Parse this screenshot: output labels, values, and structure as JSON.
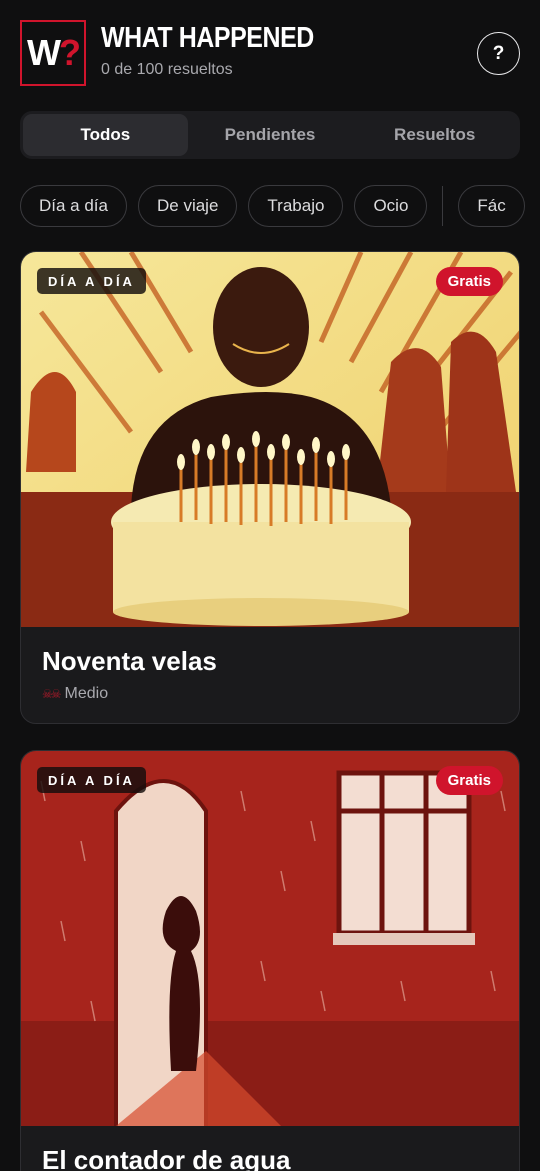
{
  "header": {
    "logo_text_main": "W",
    "logo_text_accent": "?",
    "title": "WHAT HAPPENED",
    "subtitle": "0 de 100 resueltos",
    "help_label": "?"
  },
  "tabs": [
    {
      "label": "Todos",
      "active": true
    },
    {
      "label": "Pendientes",
      "active": false
    },
    {
      "label": "Resueltos",
      "active": false
    }
  ],
  "filters": {
    "categories": [
      "Día a día",
      "De viaje",
      "Trabajo",
      "Ocio"
    ],
    "difficulty_partial": "Fác"
  },
  "cards": [
    {
      "category": "DÍA A DÍA",
      "badge": "Gratis",
      "title": "Noventa velas",
      "difficulty_icon": "skull-icons",
      "difficulty": "Medio"
    },
    {
      "category": "DÍA A DÍA",
      "badge": "Gratis",
      "title": "El contador de agua"
    }
  ],
  "colors": {
    "accent": "#d0142c",
    "background": "#0f0f10",
    "card": "#1a1a1c"
  }
}
